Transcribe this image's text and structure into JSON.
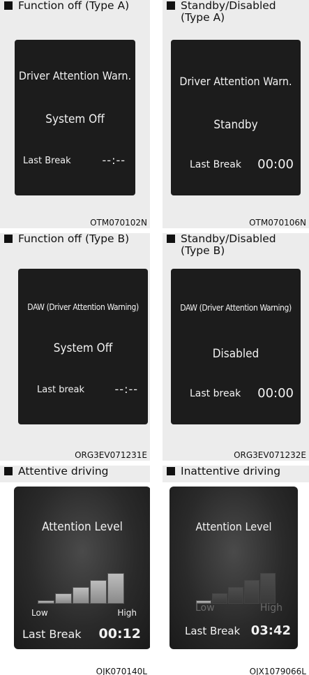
{
  "panels": [
    {
      "caption": "Function off (Type A)",
      "title": "Driver Attention Warn.",
      "status": "System Off",
      "break_label": "Last Break",
      "break_value": "--:--",
      "code": "OTM070102N"
    },
    {
      "caption": "Standby/Disabled (Type A)",
      "title": "Driver Attention Warn.",
      "status": "Standby",
      "break_label": "Last Break",
      "break_value": "00:00",
      "code": "OTM070106N"
    },
    {
      "caption": "Function off (Type B)",
      "title": "DAW (Driver Attention Warning)",
      "status": "System Off",
      "break_label": "Last break",
      "break_value": "--:--",
      "code": "ORG3EV071231E"
    },
    {
      "caption": "Standby/Disabled (Type B)",
      "title": "DAW (Driver Attention Warning)",
      "status": "Disabled",
      "break_label": "Last break",
      "break_value": "00:00",
      "code": "ORG3EV071232E"
    },
    {
      "caption": "Attentive driving",
      "title": "Attention Level",
      "low": "Low",
      "high": "High",
      "break_label": "Last Break",
      "break_value": "00:12",
      "code": "OJK070140L",
      "level_bars_lit": 5
    },
    {
      "caption": "Inattentive driving",
      "title": "Attention Level",
      "low": "Low",
      "high": "High",
      "break_label": "Last Break",
      "break_value": "03:42",
      "code": "OJX1079066L",
      "level_bars_lit": 1
    }
  ],
  "colors": {
    "panel_bg": "#ececec",
    "screen_bg": "#1c1c1c",
    "text": "#f2f2f2"
  }
}
